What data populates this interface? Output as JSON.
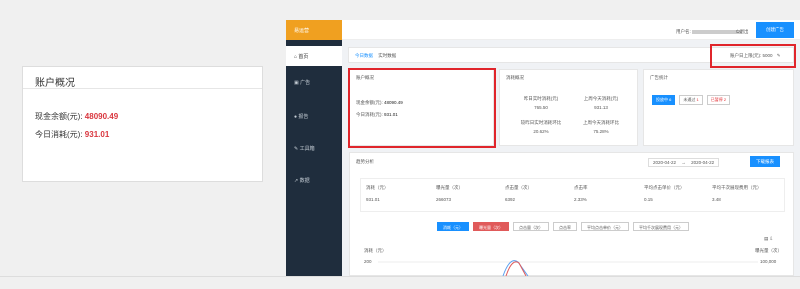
{
  "zoom_panel": {
    "title": "账户概况",
    "balance_label": "现金余额(元):",
    "balance_value": "48090.49",
    "spend_label": "今日消耗(元):",
    "spend_value": "931.01"
  },
  "app": {
    "logo": "易运营",
    "user_label": "用户名:",
    "logout": "退出",
    "create_button": "创建广告",
    "sidebar_items": [
      "首页",
      "广告",
      "报告",
      "工具箱",
      "数据"
    ],
    "breadcrumb": [
      "今日数据",
      "实时数据"
    ],
    "budget_label": "账户日上限(元):",
    "budget_value": "5000",
    "account_card": {
      "title": "账户概况",
      "balance_label": "现金余额(元):",
      "balance_value": "48090.49",
      "spend_label": "今日消耗(元):",
      "spend_value": "931.01"
    },
    "spend_card": {
      "title": "消耗概况",
      "cells": [
        {
          "label": "昨日实时消耗(元)",
          "value": "765.50"
        },
        {
          "label": "上周今天消耗(元)",
          "value": "931.13"
        },
        {
          "label": "较昨日实时消耗环比",
          "value": "20.62%"
        },
        {
          "label": "上周今天消耗环比",
          "value": "75.28%"
        }
      ]
    },
    "ad_card": {
      "title": "广告统计",
      "chips": [
        {
          "label": "投放中",
          "count": "6"
        },
        {
          "label": "未通过",
          "count": "1"
        },
        {
          "label": "已暂停",
          "count": "2"
        }
      ]
    },
    "trend": {
      "title": "趋势分析",
      "date_from": "2020-04-22",
      "date_to": "2020-04-22",
      "download": "下载报表",
      "metrics": [
        {
          "label": "消耗（元）",
          "value": "931.01"
        },
        {
          "label": "曝光量（次）",
          "value": "266073"
        },
        {
          "label": "点击量（次）",
          "value": "6392"
        },
        {
          "label": "点击率",
          "value": "2.33%"
        },
        {
          "label": "平均点击单价（元）",
          "value": "0.15"
        },
        {
          "label": "平均千次展现费用（元）",
          "value": "3.48"
        }
      ],
      "tabs": [
        "消耗（元）",
        "曝光量（次）",
        "点击量（次）",
        "点击率",
        "平均点击单价（元）",
        "平均千次展现费用（元）"
      ],
      "y_left_label": "消耗（元）",
      "y_right_label": "曝光量（次）",
      "y_left_top": "200",
      "y_right_top": "100,000"
    }
  }
}
